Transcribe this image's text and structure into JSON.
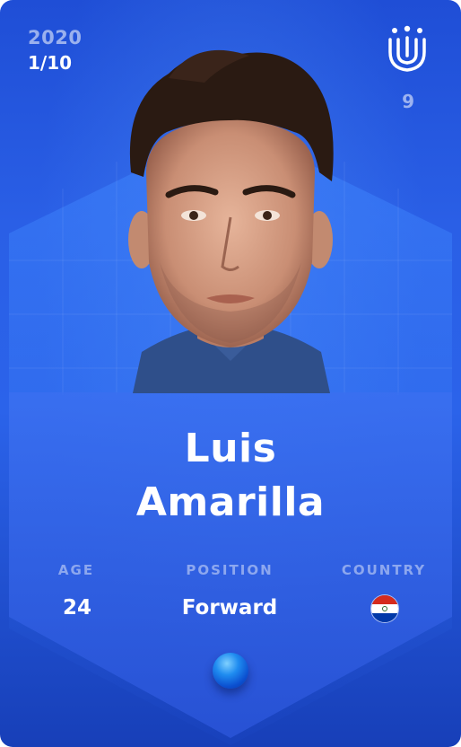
{
  "card": {
    "season": "2020",
    "serial": "1/10",
    "shirt_number": "9",
    "first_name": "Luis",
    "last_name": "Amarilla"
  },
  "stats": {
    "age_label": "AGE",
    "age_value": "24",
    "position_label": "POSITION",
    "position_value": "Forward",
    "country_label": "COUNTRY",
    "country_flag": "paraguay-flag-icon"
  },
  "colors": {
    "card_blue": "#2b63ea",
    "flag_red": "#d52b1e",
    "flag_white": "#ffffff",
    "flag_blue": "#0038a8"
  },
  "icons": {
    "logo": "sorare-logo-icon",
    "rarity_gem": "gem-icon"
  }
}
